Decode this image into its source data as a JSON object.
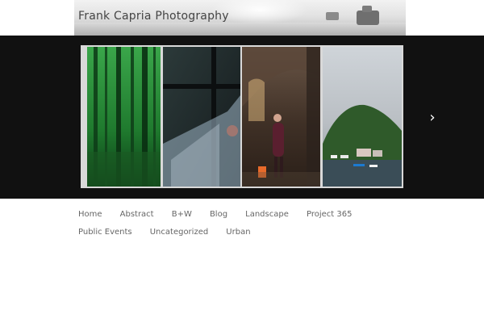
{
  "header": {
    "title": "Frank Capria Photography"
  },
  "carousel": {
    "next_arrow": "›",
    "slides": [
      {
        "name": "forest"
      },
      {
        "name": "window-rain"
      },
      {
        "name": "arcade-street-woman"
      },
      {
        "name": "lake-harbor"
      }
    ]
  },
  "nav": {
    "items": [
      "Home",
      "Abstract",
      "B+W",
      "Blog",
      "Landscape",
      "Project 365",
      "Public Events",
      "Uncategorized",
      "Urban"
    ]
  },
  "colors": {
    "carousel_bg": "#111111",
    "nav_text": "#666666",
    "title_text": "#444444"
  }
}
